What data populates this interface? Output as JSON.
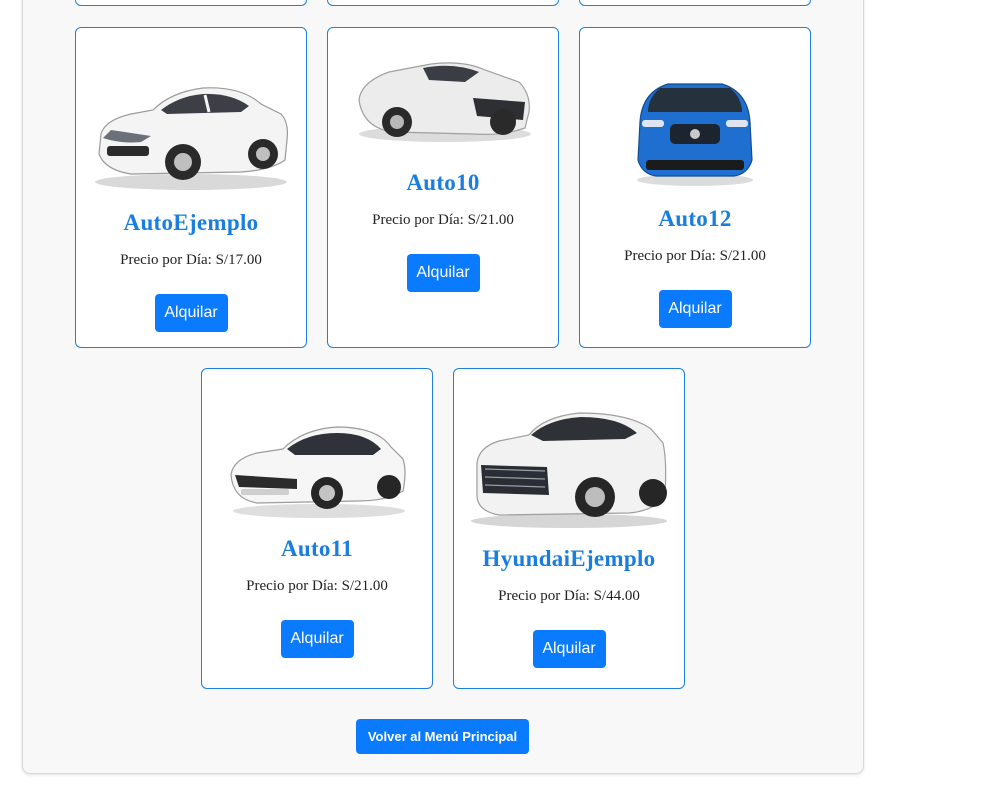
{
  "cars": [
    {
      "name": "AutoEjemplo",
      "price": "Precio por Día: S/17.00",
      "button": "Alquilar",
      "image": "white-sedan-image"
    },
    {
      "name": "Auto10",
      "price": "Precio por Día: S/21.00",
      "button": "Alquilar",
      "image": "silver-sports-car-image"
    },
    {
      "name": "Auto12",
      "price": "Precio por Día: S/21.00",
      "button": "Alquilar",
      "image": "blue-suv-image"
    },
    {
      "name": "Auto11",
      "price": "Precio por Día: S/21.00",
      "button": "Alquilar",
      "image": "white-sedan-image"
    },
    {
      "name": "HyundaiEjemplo",
      "price": "Precio por Día: S/44.00",
      "button": "Alquilar",
      "image": "white-suv-image"
    }
  ],
  "back_button": "Volver al Menú Principal",
  "colors": {
    "accent": "#0a7bff",
    "title": "#1a7ee0",
    "card_border": "#1f7fe0"
  }
}
